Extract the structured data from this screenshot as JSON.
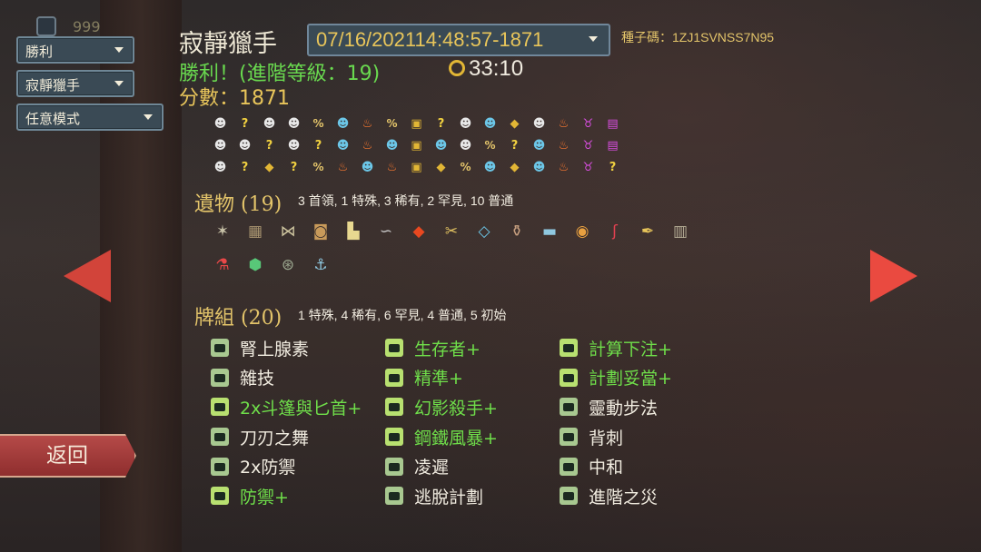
{
  "filters": {
    "result": "勝利",
    "character": "寂靜獵手",
    "mode": "任意模式"
  },
  "header": {
    "title": "寂靜獵手",
    "run": "07/16/202114:48:57-1871",
    "seed": "種子碼：1ZJ1SVNSS7N95",
    "victory": "勝利！(進階等級：19)",
    "time": "33:10",
    "score": "分數：1871"
  },
  "path": [
    [
      "monster",
      "unknown",
      "monster",
      "monster",
      "shop-unknown",
      "elite",
      "rest",
      "monster-unknown",
      "treasure",
      "unknown",
      "monster",
      "elite",
      "gold",
      "monster",
      "rest",
      "boss",
      "chest"
    ],
    [
      "monster",
      "monster",
      "unknown",
      "monster",
      "unknown",
      "elite",
      "rest",
      "elite",
      "treasure",
      "elite",
      "monster",
      "shop-unknown",
      "unknown",
      "elite",
      "rest",
      "boss",
      "chest"
    ],
    [
      "monster",
      "unknown",
      "gold",
      "unknown",
      "shop-unknown",
      "rest",
      "elite",
      "rest",
      "treasure",
      "gold",
      "monster-unknown",
      "elite",
      "gold",
      "elite",
      "rest",
      "boss",
      "unknown"
    ]
  ],
  "relics": {
    "title": "遺物",
    "count": "(19)",
    "summary": "3 首領, 1 特殊, 3 稀有, 2 罕見, 10 普通",
    "items_row1": [
      "ninja-scroll",
      "war-paint-wood",
      "whetstone-bridge",
      "bag-of-preparation",
      "kunai",
      "snecko",
      "red-gem",
      "wrist-blade",
      "ornamental-fan",
      "vase",
      "tungsten-rod",
      "nilrys-codex",
      "horn",
      "pen-nib",
      "bird-cage"
    ],
    "items_row2": [
      "potion-belt",
      "lantern",
      "tingsha",
      "anchor"
    ]
  },
  "deck": {
    "title": "牌組",
    "count": "(20)",
    "summary": "1 特殊, 4 稀有, 6 罕見, 4 普通, 5 初始",
    "col1": [
      {
        "name": "腎上腺素",
        "upgraded": false
      },
      {
        "name": "雜技",
        "upgraded": false
      },
      {
        "name": "2x斗篷與匕首+",
        "upgraded": true
      },
      {
        "name": "刀刃之舞",
        "upgraded": false
      },
      {
        "name": "2x防禦",
        "upgraded": false
      },
      {
        "name": "防禦+",
        "upgraded": true
      }
    ],
    "col2": [
      {
        "name": "生存者+",
        "upgraded": true
      },
      {
        "name": "精準+",
        "upgraded": true
      },
      {
        "name": "幻影殺手+",
        "upgraded": true
      },
      {
        "name": "鋼鐵風暴+",
        "upgraded": true
      },
      {
        "name": "凌遲",
        "upgraded": false
      },
      {
        "name": "逃脫計劃",
        "upgraded": false
      }
    ],
    "col3": [
      {
        "name": "計算下注+",
        "upgraded": true
      },
      {
        "name": "計劃妥當+",
        "upgraded": true
      },
      {
        "name": "靈動步法",
        "upgraded": false
      },
      {
        "name": "背刺",
        "upgraded": false
      },
      {
        "name": "中和",
        "upgraded": false
      },
      {
        "name": "進階之災",
        "upgraded": false
      }
    ]
  },
  "nav": {
    "back": "返回",
    "prev": "previous-run",
    "next": "next-run"
  },
  "colors": {
    "victory_green": "#69d94f",
    "gold": "#e3c46a",
    "upgraded_card": "#6fdf4a",
    "arrow_red": "#ea4a40"
  }
}
